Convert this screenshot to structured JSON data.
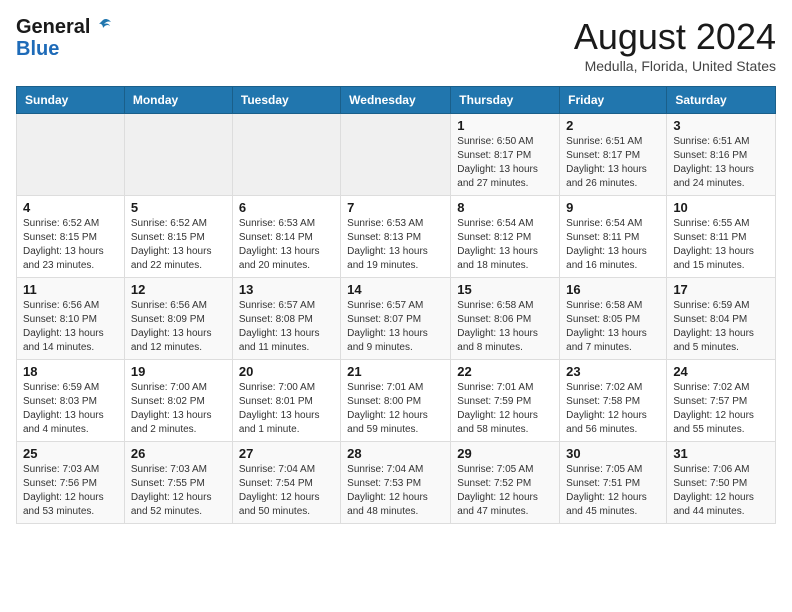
{
  "header": {
    "logo_general": "General",
    "logo_blue": "Blue",
    "month_title": "August 2024",
    "location": "Medulla, Florida, United States"
  },
  "calendar": {
    "days_of_week": [
      "Sunday",
      "Monday",
      "Tuesday",
      "Wednesday",
      "Thursday",
      "Friday",
      "Saturday"
    ],
    "weeks": [
      [
        {
          "day": "",
          "info": ""
        },
        {
          "day": "",
          "info": ""
        },
        {
          "day": "",
          "info": ""
        },
        {
          "day": "",
          "info": ""
        },
        {
          "day": "1",
          "info": "Sunrise: 6:50 AM\nSunset: 8:17 PM\nDaylight: 13 hours\nand 27 minutes."
        },
        {
          "day": "2",
          "info": "Sunrise: 6:51 AM\nSunset: 8:17 PM\nDaylight: 13 hours\nand 26 minutes."
        },
        {
          "day": "3",
          "info": "Sunrise: 6:51 AM\nSunset: 8:16 PM\nDaylight: 13 hours\nand 24 minutes."
        }
      ],
      [
        {
          "day": "4",
          "info": "Sunrise: 6:52 AM\nSunset: 8:15 PM\nDaylight: 13 hours\nand 23 minutes."
        },
        {
          "day": "5",
          "info": "Sunrise: 6:52 AM\nSunset: 8:15 PM\nDaylight: 13 hours\nand 22 minutes."
        },
        {
          "day": "6",
          "info": "Sunrise: 6:53 AM\nSunset: 8:14 PM\nDaylight: 13 hours\nand 20 minutes."
        },
        {
          "day": "7",
          "info": "Sunrise: 6:53 AM\nSunset: 8:13 PM\nDaylight: 13 hours\nand 19 minutes."
        },
        {
          "day": "8",
          "info": "Sunrise: 6:54 AM\nSunset: 8:12 PM\nDaylight: 13 hours\nand 18 minutes."
        },
        {
          "day": "9",
          "info": "Sunrise: 6:54 AM\nSunset: 8:11 PM\nDaylight: 13 hours\nand 16 minutes."
        },
        {
          "day": "10",
          "info": "Sunrise: 6:55 AM\nSunset: 8:11 PM\nDaylight: 13 hours\nand 15 minutes."
        }
      ],
      [
        {
          "day": "11",
          "info": "Sunrise: 6:56 AM\nSunset: 8:10 PM\nDaylight: 13 hours\nand 14 minutes."
        },
        {
          "day": "12",
          "info": "Sunrise: 6:56 AM\nSunset: 8:09 PM\nDaylight: 13 hours\nand 12 minutes."
        },
        {
          "day": "13",
          "info": "Sunrise: 6:57 AM\nSunset: 8:08 PM\nDaylight: 13 hours\nand 11 minutes."
        },
        {
          "day": "14",
          "info": "Sunrise: 6:57 AM\nSunset: 8:07 PM\nDaylight: 13 hours\nand 9 minutes."
        },
        {
          "day": "15",
          "info": "Sunrise: 6:58 AM\nSunset: 8:06 PM\nDaylight: 13 hours\nand 8 minutes."
        },
        {
          "day": "16",
          "info": "Sunrise: 6:58 AM\nSunset: 8:05 PM\nDaylight: 13 hours\nand 7 minutes."
        },
        {
          "day": "17",
          "info": "Sunrise: 6:59 AM\nSunset: 8:04 PM\nDaylight: 13 hours\nand 5 minutes."
        }
      ],
      [
        {
          "day": "18",
          "info": "Sunrise: 6:59 AM\nSunset: 8:03 PM\nDaylight: 13 hours\nand 4 minutes."
        },
        {
          "day": "19",
          "info": "Sunrise: 7:00 AM\nSunset: 8:02 PM\nDaylight: 13 hours\nand 2 minutes."
        },
        {
          "day": "20",
          "info": "Sunrise: 7:00 AM\nSunset: 8:01 PM\nDaylight: 13 hours\nand 1 minute."
        },
        {
          "day": "21",
          "info": "Sunrise: 7:01 AM\nSunset: 8:00 PM\nDaylight: 12 hours\nand 59 minutes."
        },
        {
          "day": "22",
          "info": "Sunrise: 7:01 AM\nSunset: 7:59 PM\nDaylight: 12 hours\nand 58 minutes."
        },
        {
          "day": "23",
          "info": "Sunrise: 7:02 AM\nSunset: 7:58 PM\nDaylight: 12 hours\nand 56 minutes."
        },
        {
          "day": "24",
          "info": "Sunrise: 7:02 AM\nSunset: 7:57 PM\nDaylight: 12 hours\nand 55 minutes."
        }
      ],
      [
        {
          "day": "25",
          "info": "Sunrise: 7:03 AM\nSunset: 7:56 PM\nDaylight: 12 hours\nand 53 minutes."
        },
        {
          "day": "26",
          "info": "Sunrise: 7:03 AM\nSunset: 7:55 PM\nDaylight: 12 hours\nand 52 minutes."
        },
        {
          "day": "27",
          "info": "Sunrise: 7:04 AM\nSunset: 7:54 PM\nDaylight: 12 hours\nand 50 minutes."
        },
        {
          "day": "28",
          "info": "Sunrise: 7:04 AM\nSunset: 7:53 PM\nDaylight: 12 hours\nand 48 minutes."
        },
        {
          "day": "29",
          "info": "Sunrise: 7:05 AM\nSunset: 7:52 PM\nDaylight: 12 hours\nand 47 minutes."
        },
        {
          "day": "30",
          "info": "Sunrise: 7:05 AM\nSunset: 7:51 PM\nDaylight: 12 hours\nand 45 minutes."
        },
        {
          "day": "31",
          "info": "Sunrise: 7:06 AM\nSunset: 7:50 PM\nDaylight: 12 hours\nand 44 minutes."
        }
      ]
    ]
  }
}
